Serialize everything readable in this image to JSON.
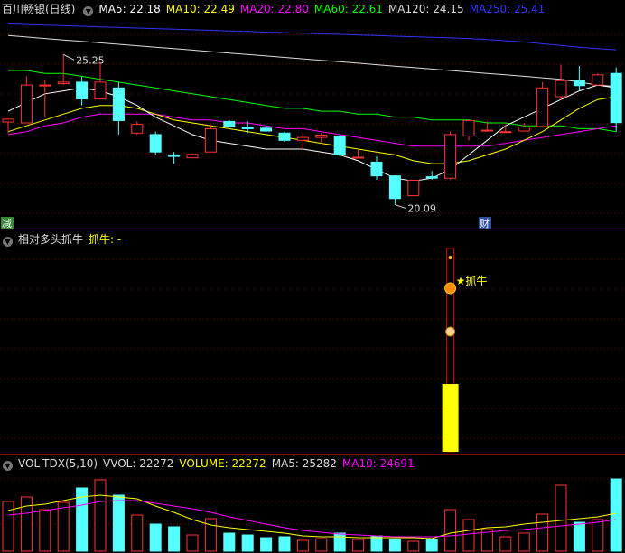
{
  "header": {
    "stock_name": "百川畅银(日线)",
    "ma": [
      {
        "label": "MA5: 22.18",
        "color": "#ffffff"
      },
      {
        "label": "MA10: 22.49",
        "color": "#ffff00"
      },
      {
        "label": "MA20: 22.80",
        "color": "#ff00ff"
      },
      {
        "label": "MA60: 22.61",
        "color": "#00ff00"
      },
      {
        "label": "MA120: 24.15",
        "color": "#dddddd"
      },
      {
        "label": "MA250: 25.41",
        "color": "#3333ff"
      }
    ]
  },
  "indicator_header": {
    "name": "相对多头抓牛",
    "label": "抓牛: -",
    "signal_text": "★抓牛"
  },
  "volume_header": {
    "name": "VOL-TDX(5,10)",
    "items": [
      {
        "label": "VVOL: 22272",
        "color": "#dddddd"
      },
      {
        "label": "VOLUME: 22272",
        "color": "#ffff00"
      },
      {
        "label": "MA5: 25282",
        "color": "#dddddd"
      },
      {
        "label": "MA10: 24691",
        "color": "#ff00ff"
      }
    ]
  },
  "markers": {
    "jian": "减",
    "cai": "财",
    "high_label": "25.25",
    "low_label": "20.09"
  },
  "colors": {
    "up": "#ff3232",
    "down": "#54ffff",
    "ma5": "#ffffff",
    "ma10": "#ffff00",
    "ma20": "#ff00ff",
    "ma60": "#00ff00",
    "ma120": "#dddddd",
    "ma250": "#3333ff",
    "signal": "#ffff00"
  },
  "chart_data": [
    {
      "type": "candlestick",
      "title": "百川畅银(日线)",
      "ylim": [
        19.3,
        26.5
      ],
      "candles": [
        {
          "o": 22.93,
          "h": 23.05,
          "l": 22.55,
          "c": 23.03
        },
        {
          "o": 22.9,
          "h": 24.5,
          "l": 22.9,
          "c": 24.2
        },
        {
          "o": 24.2,
          "h": 24.4,
          "l": 23.1,
          "c": 24.2
        },
        {
          "o": 24.25,
          "h": 25.25,
          "l": 24.2,
          "c": 24.3
        },
        {
          "o": 24.3,
          "h": 24.5,
          "l": 23.5,
          "c": 23.72
        },
        {
          "o": 23.72,
          "h": 25.0,
          "l": 23.7,
          "c": 24.3
        },
        {
          "o": 24.1,
          "h": 24.3,
          "l": 22.5,
          "c": 22.98
        },
        {
          "o": 22.55,
          "h": 22.95,
          "l": 22.5,
          "c": 22.85
        },
        {
          "o": 22.5,
          "h": 22.6,
          "l": 21.8,
          "c": 21.9
        },
        {
          "o": 21.8,
          "h": 21.9,
          "l": 21.5,
          "c": 21.75
        },
        {
          "o": 21.7,
          "h": 21.85,
          "l": 21.7,
          "c": 21.82
        },
        {
          "o": 21.9,
          "h": 22.85,
          "l": 21.9,
          "c": 22.7
        },
        {
          "o": 22.95,
          "h": 23.0,
          "l": 22.75,
          "c": 22.78
        },
        {
          "o": 22.75,
          "h": 22.95,
          "l": 22.55,
          "c": 22.7
        },
        {
          "o": 22.72,
          "h": 22.85,
          "l": 22.6,
          "c": 22.62
        },
        {
          "o": 22.55,
          "h": 22.6,
          "l": 22.25,
          "c": 22.3
        },
        {
          "o": 22.3,
          "h": 22.55,
          "l": 22.0,
          "c": 22.4
        },
        {
          "o": 22.4,
          "h": 22.55,
          "l": 22.2,
          "c": 22.48
        },
        {
          "o": 22.45,
          "h": 22.5,
          "l": 21.75,
          "c": 21.83
        },
        {
          "o": 21.7,
          "h": 22.0,
          "l": 21.7,
          "c": 21.72
        },
        {
          "o": 21.55,
          "h": 21.75,
          "l": 20.95,
          "c": 21.08
        },
        {
          "o": 21.08,
          "h": 21.1,
          "l": 20.09,
          "c": 20.3
        },
        {
          "o": 20.4,
          "h": 20.95,
          "l": 20.4,
          "c": 20.93
        },
        {
          "o": 21.05,
          "h": 21.25,
          "l": 20.95,
          "c": 21.0
        },
        {
          "o": 21.0,
          "h": 22.6,
          "l": 20.95,
          "c": 22.5
        },
        {
          "o": 22.45,
          "h": 23.0,
          "l": 22.3,
          "c": 22.98
        },
        {
          "o": 22.62,
          "h": 22.95,
          "l": 22.6,
          "c": 22.65
        },
        {
          "o": 22.58,
          "h": 22.85,
          "l": 22.55,
          "c": 22.6
        },
        {
          "o": 22.62,
          "h": 22.9,
          "l": 22.6,
          "c": 22.76
        },
        {
          "o": 22.78,
          "h": 24.3,
          "l": 22.75,
          "c": 24.1
        },
        {
          "o": 23.8,
          "h": 24.9,
          "l": 23.7,
          "c": 24.35
        },
        {
          "o": 24.35,
          "h": 24.85,
          "l": 24.0,
          "c": 24.18
        },
        {
          "o": 24.2,
          "h": 24.6,
          "l": 24.2,
          "c": 24.55
        },
        {
          "o": 24.6,
          "h": 24.8,
          "l": 22.6,
          "c": 22.91
        }
      ],
      "ma5": [
        23.3,
        23.6,
        23.9,
        24.0,
        24.1,
        24.0,
        23.8,
        23.5,
        23.1,
        22.8,
        22.5,
        22.3,
        22.2,
        22.1,
        22.0,
        22.0,
        22.0,
        21.9,
        21.8,
        21.6,
        21.3,
        21.0,
        20.9,
        21.0,
        21.3,
        21.8,
        22.3,
        22.8,
        23.1,
        23.4,
        23.7,
        24.0,
        24.2,
        24.1
      ],
      "ma10": [
        22.6,
        22.8,
        23.0,
        23.2,
        23.4,
        23.5,
        23.5,
        23.4,
        23.2,
        23.0,
        22.9,
        22.8,
        22.7,
        22.6,
        22.5,
        22.4,
        22.3,
        22.2,
        22.1,
        22.0,
        21.9,
        21.8,
        21.6,
        21.5,
        21.5,
        21.6,
        21.8,
        22.0,
        22.3,
        22.6,
        23.0,
        23.4,
        23.7,
        23.8
      ],
      "ma20": [
        22.5,
        22.6,
        22.8,
        22.9,
        23.1,
        23.2,
        23.2,
        23.2,
        23.2,
        23.1,
        23.0,
        23.0,
        22.9,
        22.9,
        22.8,
        22.7,
        22.7,
        22.6,
        22.5,
        22.4,
        22.3,
        22.2,
        22.1,
        22.1,
        22.1,
        22.1,
        22.1,
        22.2,
        22.3,
        22.4,
        22.5,
        22.6,
        22.7,
        22.8
      ],
      "ma60": [
        24.7,
        24.7,
        24.6,
        24.6,
        24.5,
        24.4,
        24.3,
        24.2,
        24.1,
        24.0,
        23.9,
        23.8,
        23.7,
        23.6,
        23.5,
        23.4,
        23.4,
        23.3,
        23.3,
        23.2,
        23.2,
        23.1,
        23.1,
        23.0,
        23.0,
        23.0,
        22.9,
        22.9,
        22.8,
        22.8,
        22.8,
        22.7,
        22.7,
        22.6
      ],
      "ma120": [
        25.9,
        25.85,
        25.8,
        25.75,
        25.7,
        25.65,
        25.6,
        25.55,
        25.5,
        25.45,
        25.4,
        25.35,
        25.3,
        25.25,
        25.2,
        25.15,
        25.1,
        25.05,
        25.0,
        24.95,
        24.9,
        24.85,
        24.8,
        24.75,
        24.7,
        24.65,
        24.6,
        24.55,
        24.5,
        24.45,
        24.4,
        24.3,
        24.2,
        24.15
      ],
      "ma250": [
        26.3,
        26.28,
        26.26,
        26.24,
        26.22,
        26.2,
        26.18,
        26.16,
        26.14,
        26.12,
        26.1,
        26.08,
        26.06,
        26.04,
        26.02,
        26.0,
        25.98,
        25.96,
        25.94,
        25.92,
        25.9,
        25.88,
        25.86,
        25.84,
        25.82,
        25.8,
        25.76,
        25.72,
        25.68,
        25.62,
        25.56,
        25.5,
        25.45,
        25.41
      ]
    },
    {
      "type": "bar",
      "title": "相对多头抓牛",
      "signal_index": 24,
      "ylim": [
        0,
        1
      ],
      "values": [
        0,
        0,
        0,
        0,
        0,
        0,
        0,
        0,
        0,
        0,
        0,
        0,
        0,
        0,
        0,
        0,
        0,
        0,
        0,
        0,
        0,
        0,
        0,
        0,
        1,
        0,
        0,
        0,
        0,
        0,
        0,
        0,
        0,
        0
      ]
    },
    {
      "type": "bar",
      "title": "VOL-TDX(5,10)",
      "ylim": [
        0,
        90000
      ],
      "volume": [
        55000,
        60000,
        46000,
        54000,
        70000,
        79000,
        62000,
        40000,
        30000,
        27000,
        18000,
        36000,
        20000,
        18000,
        15000,
        16000,
        12000,
        14000,
        20000,
        13000,
        17000,
        13000,
        11000,
        13000,
        46000,
        35000,
        24000,
        16000,
        20000,
        41000,
        73000,
        32000,
        35000,
        80000
      ],
      "vma5": [
        45000,
        50000,
        52000,
        56000,
        60000,
        62000,
        60000,
        58000,
        50000,
        43000,
        35000,
        29000,
        26000,
        24000,
        22000,
        20000,
        17000,
        16000,
        16000,
        15000,
        15000,
        15000,
        15000,
        14000,
        20000,
        23000,
        26000,
        27000,
        30000,
        32000,
        34000,
        36000,
        38000,
        42000
      ],
      "vma10": [
        40000,
        42000,
        45000,
        48000,
        51000,
        55000,
        56000,
        56000,
        53000,
        50000,
        47000,
        43000,
        38000,
        34000,
        30000,
        26000,
        23000,
        21000,
        19000,
        18000,
        17000,
        16000,
        16000,
        16000,
        17000,
        19000,
        21000,
        23000,
        24000,
        26000,
        28000,
        30000,
        32000,
        35000
      ]
    }
  ]
}
